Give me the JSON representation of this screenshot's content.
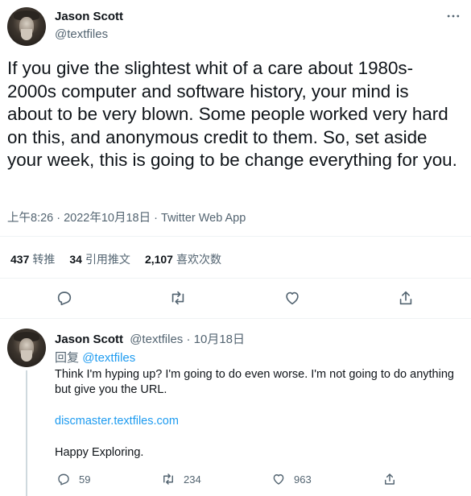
{
  "tweet": {
    "author_name": "Jason Scott",
    "author_handle": "@textfiles",
    "text": "If you give the slightest whit of a care about 1980s-2000s computer and software history, your mind is about to be very blown. Some people worked very hard on this, and anonymous credit to them. So, set aside your week, this is going to be change everything for you.",
    "meta": "上午8:26 · 2022年10月18日 · Twitter Web App",
    "stats": {
      "retweets_count": "437",
      "retweets_label": "转推",
      "quotes_count": "34",
      "quotes_label": "引用推文",
      "likes_count": "2,107",
      "likes_label": "喜欢次数"
    }
  },
  "reply": {
    "author_name": "Jason Scott",
    "author_handle": "@textfiles",
    "separator": "·",
    "date": "10月18日",
    "replying_prefix": "回复",
    "replying_handle": "@textfiles",
    "body": {
      "line1": "Think I'm hyping up? I'm going to do even worse. I'm not going to do anything but give you the URL.",
      "url": "discmaster.textfiles.com",
      "line3": "Happy Exploring."
    },
    "counts": {
      "replies": "59",
      "retweets": "234",
      "likes": "963"
    }
  },
  "icons": [
    "more-icon",
    "reply-icon",
    "retweet-icon",
    "like-icon",
    "share-icon"
  ],
  "colors": {
    "text": "#0f1419",
    "muted": "#536471",
    "link": "#1d9bf0",
    "divider": "#eff3f4"
  }
}
